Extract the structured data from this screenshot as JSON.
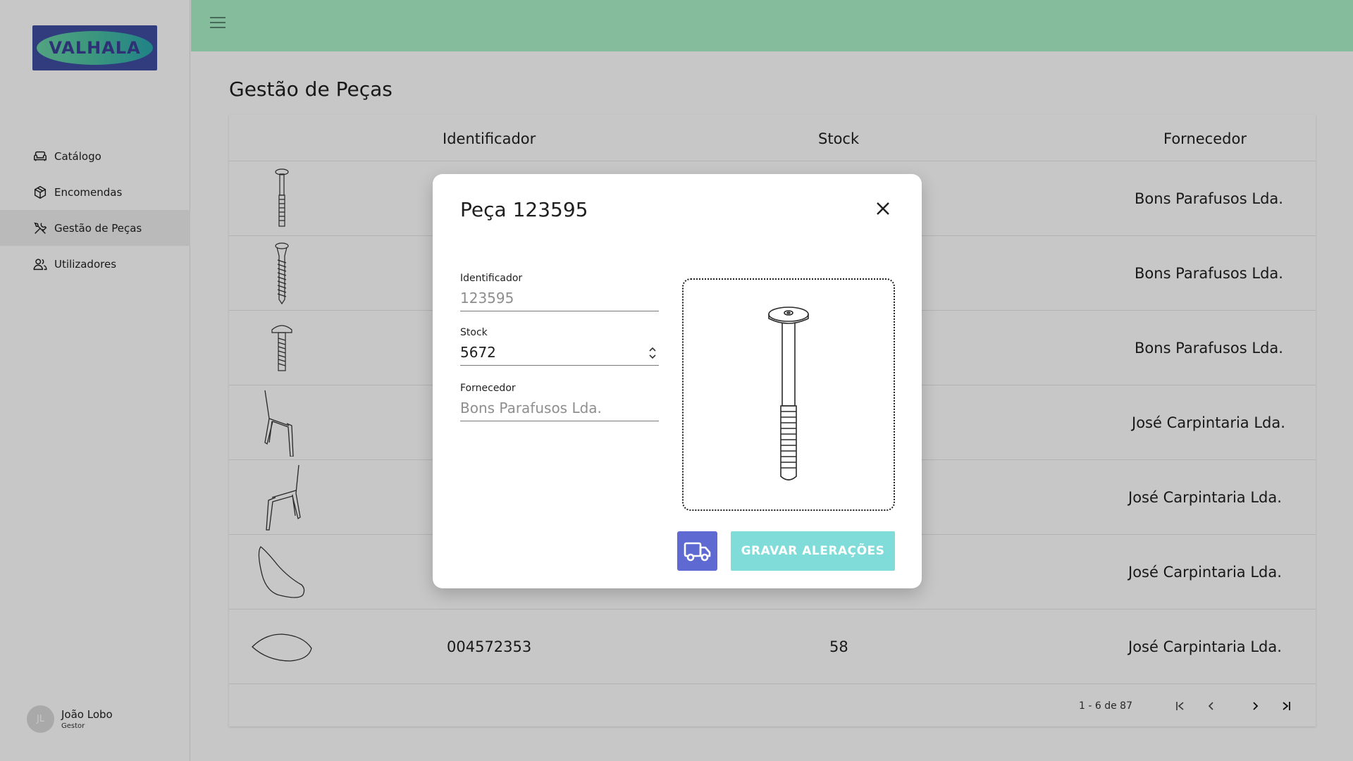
{
  "brand": {
    "logo_text": "VALHALA"
  },
  "sidebar": {
    "items": [
      {
        "label": "Catálogo",
        "icon": "sofa-icon"
      },
      {
        "label": "Encomendas",
        "icon": "package-icon"
      },
      {
        "label": "Gestão de Peças",
        "icon": "tools-icon",
        "active": true
      },
      {
        "label": "Utilizadores",
        "icon": "users-icon"
      }
    ],
    "user": {
      "initials": "JL",
      "name": "João Lobo",
      "role": "Gestor"
    }
  },
  "header": {
    "menu_icon": "hamburger-icon"
  },
  "page": {
    "title": "Gestão de Peças"
  },
  "table": {
    "columns": [
      "Identificador",
      "Stock",
      "Fornecedor"
    ],
    "rows": [
      {
        "image": "bolt-long",
        "id": "",
        "stock": "",
        "supplier": "Bons Parafusos Lda."
      },
      {
        "image": "screw-wood",
        "id": "",
        "stock": "",
        "supplier": "Bons Parafusos Lda."
      },
      {
        "image": "screw-short",
        "id": "",
        "stock": "",
        "supplier": "Bons Parafusos Lda."
      },
      {
        "image": "chair-frame-a",
        "id": "",
        "stock": "",
        "supplier": "José Carpintaria Lda."
      },
      {
        "image": "chair-frame-b",
        "id": "",
        "stock": "",
        "supplier": "José Carpintaria Lda."
      },
      {
        "image": "chair-shell",
        "id": "",
        "stock": "",
        "supplier": "José Carpintaria Lda."
      },
      {
        "image": "seat-panel",
        "id": "004572353",
        "stock": "58",
        "supplier": "José Carpintaria Lda."
      }
    ],
    "pagination": {
      "label": "1 - 6 de 87"
    }
  },
  "modal": {
    "title": "Peça 123595",
    "fields": {
      "id_label": "Identificador",
      "id_value": "123595",
      "stock_label": "Stock",
      "stock_value": "5672",
      "supplier_label": "Fornecedor",
      "supplier_value": "Bons Parafusos Lda."
    },
    "save_label": "GRAVAR ALERAÇÕES",
    "truck_icon": "truck-icon",
    "close_icon": "close-icon"
  },
  "colors": {
    "topbar": "#a9f1c8",
    "logo_bg": "#3f4ea3",
    "truck_button": "#5e6ad2",
    "save_button": "#7fdcd8"
  }
}
